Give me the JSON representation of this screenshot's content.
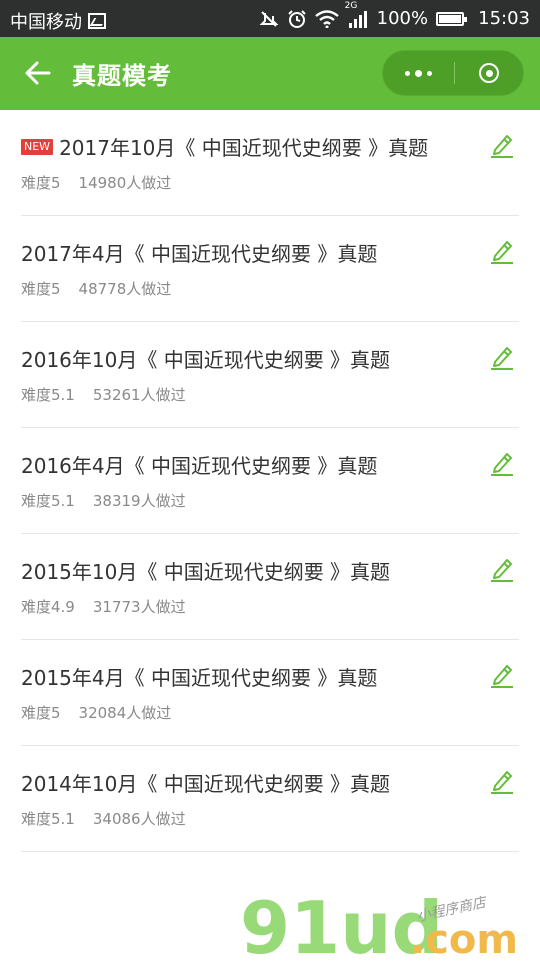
{
  "status_bar": {
    "carrier": "中国移动",
    "network": "2G",
    "battery": "100%",
    "battery_level": 1.0,
    "time": "15:03",
    "icons": [
      "gallery-icon",
      "mute-icon",
      "alarm-icon",
      "wifi-icon",
      "signal-icon",
      "battery-icon"
    ]
  },
  "header": {
    "title": "真题模考",
    "back_icon": "arrow-left-icon",
    "more_icon": "more-dots-icon",
    "close_icon": "target-icon",
    "accent_color": "#64bd3a"
  },
  "list": {
    "items": [
      {
        "badge": "NEW",
        "title": "2017年10月《 中国近现代史纲要 》真题",
        "difficulty": "难度5",
        "count": "14980人做过"
      },
      {
        "badge": "",
        "title": "2017年4月《 中国近现代史纲要 》真题",
        "difficulty": "难度5",
        "count": "48778人做过"
      },
      {
        "badge": "",
        "title": "2016年10月《 中国近现代史纲要 》真题",
        "difficulty": "难度5.1",
        "count": "53261人做过"
      },
      {
        "badge": "",
        "title": "2016年4月《 中国近现代史纲要 》真题",
        "difficulty": "难度5.1",
        "count": "38319人做过"
      },
      {
        "badge": "",
        "title": "2015年10月《 中国近现代史纲要 》真题",
        "difficulty": "难度4.9",
        "count": "31773人做过"
      },
      {
        "badge": "",
        "title": "2015年4月《 中国近现代史纲要 》真题",
        "difficulty": "难度5",
        "count": "32084人做过"
      },
      {
        "badge": "",
        "title": "2014年10月《 中国近现代史纲要 》真题",
        "difficulty": "难度5.1",
        "count": "34086人做过"
      }
    ],
    "edit_icon": "pencil-icon"
  },
  "watermark": {
    "brand": "91ud",
    "domain": ".com",
    "tagline": "小程序商店"
  }
}
